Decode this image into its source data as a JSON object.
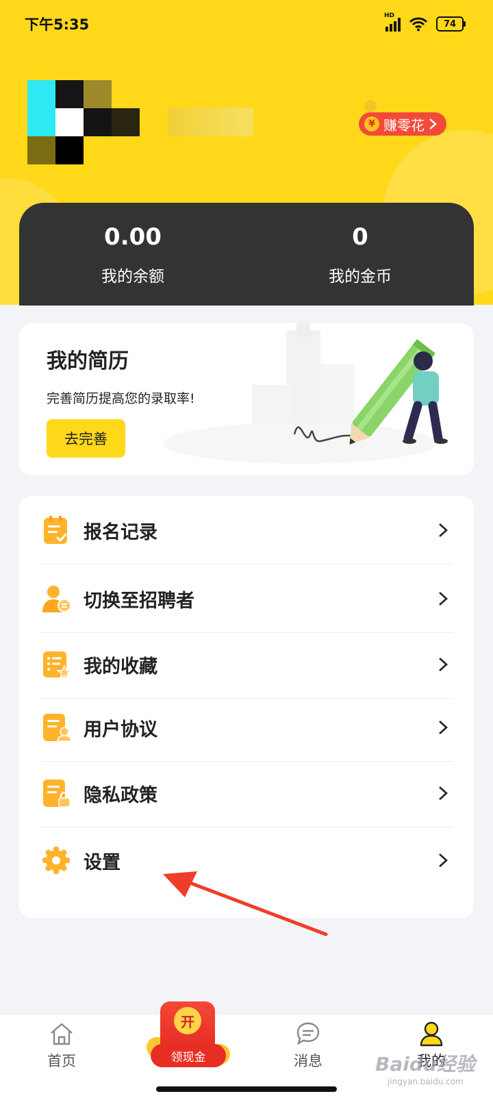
{
  "status_bar": {
    "time": "下午5:35",
    "network": "HD",
    "battery": "74"
  },
  "profile": {
    "earn_label": "赚零花",
    "earn_coin": "¥"
  },
  "wallet": {
    "balance_value": "0.00",
    "balance_label": "我的余额",
    "coins_value": "0",
    "coins_label": "我的金币"
  },
  "resume": {
    "title": "我的简历",
    "description": "完善简历提高您的录取率!",
    "button": "去完善"
  },
  "menu": {
    "items": [
      {
        "label": "报名记录",
        "icon": "signup-record-icon"
      },
      {
        "label": "切换至招聘者",
        "icon": "switch-recruiter-icon"
      },
      {
        "label": "我的收藏",
        "icon": "favorites-icon"
      },
      {
        "label": "用户协议",
        "icon": "user-agreement-icon"
      },
      {
        "label": "隐私政策",
        "icon": "privacy-policy-icon"
      },
      {
        "label": "设置",
        "icon": "settings-gear-icon"
      }
    ]
  },
  "tabbar": {
    "home": "首页",
    "cash_open": "开",
    "cash": "领现金",
    "messages": "消息",
    "mine": "我的"
  },
  "watermark": {
    "main": "Baidu经验",
    "sub": "jingyan.baidu.com"
  },
  "colors": {
    "brand_yellow": "#FFD81A",
    "wallet_dark": "#333333",
    "accent_red": "#F24A3A",
    "icon_orange": "#FFB020"
  }
}
